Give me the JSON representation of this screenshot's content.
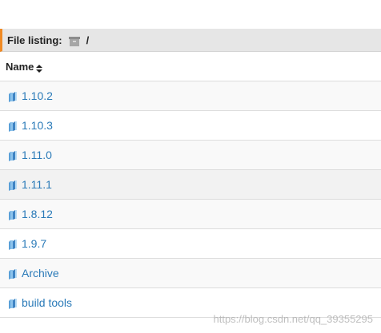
{
  "header": {
    "label": "File listing:",
    "path": "/",
    "accent_color": "#f08a24",
    "icon": "archive-icon"
  },
  "table": {
    "column_name": "Name",
    "sort_icon": "sort-both-icon",
    "rows": [
      {
        "name": "1.10.2",
        "icon": "folder-icon"
      },
      {
        "name": "1.10.3",
        "icon": "folder-icon"
      },
      {
        "name": "1.11.0",
        "icon": "folder-icon"
      },
      {
        "name": "1.11.1",
        "icon": "folder-icon"
      },
      {
        "name": "1.8.12",
        "icon": "folder-icon"
      },
      {
        "name": "1.9.7",
        "icon": "folder-icon"
      },
      {
        "name": "Archive",
        "icon": "folder-icon"
      },
      {
        "name": "build tools",
        "icon": "folder-icon"
      }
    ]
  },
  "watermark": "https://blog.csdn.net/qq_39355295",
  "colors": {
    "link": "#2a7ab8",
    "header_bg": "#e6e6e6"
  }
}
